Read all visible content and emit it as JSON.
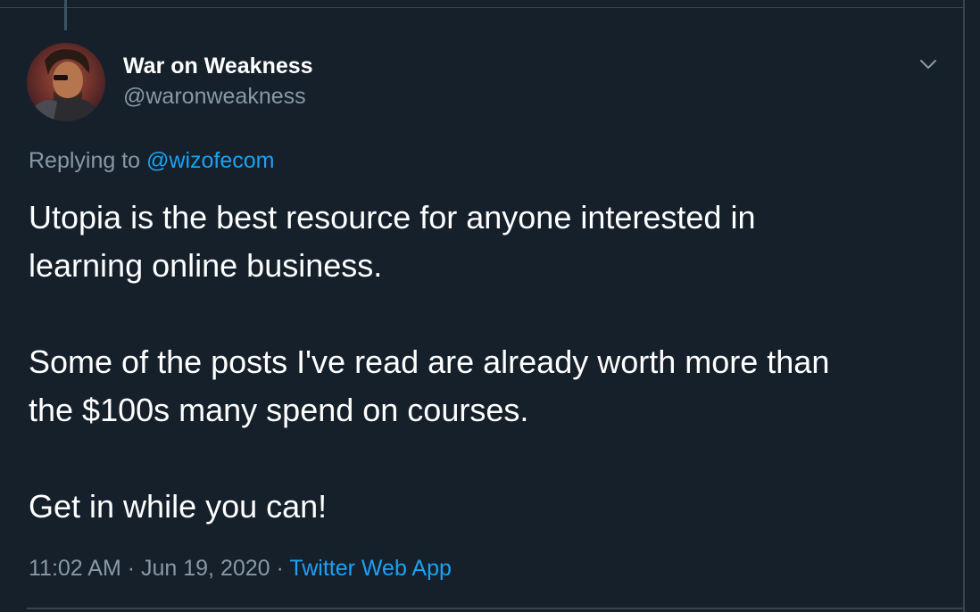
{
  "tweet": {
    "author": {
      "display_name": "War on Weakness",
      "handle": "@waronweakness"
    },
    "reply_context": {
      "prefix": "Replying to ",
      "mention": "@wizofecom"
    },
    "body_lines": [
      "Utopia is the best resource for anyone interested in",
      "learning online business.",
      "Some of the posts I've read are already worth more than",
      "the $100s many spend on courses.",
      "Get in while you can!"
    ],
    "meta": {
      "time": "11:02 AM",
      "separator": " · ",
      "date": "Jun 19, 2020",
      "source": "Twitter Web App"
    }
  },
  "icons": {
    "more": "chevron-down-icon"
  },
  "colors": {
    "background": "#15202b",
    "primary_text": "#ffffff",
    "secondary_text": "#8899a6",
    "accent": "#1da1f2",
    "border": "#38444d"
  }
}
